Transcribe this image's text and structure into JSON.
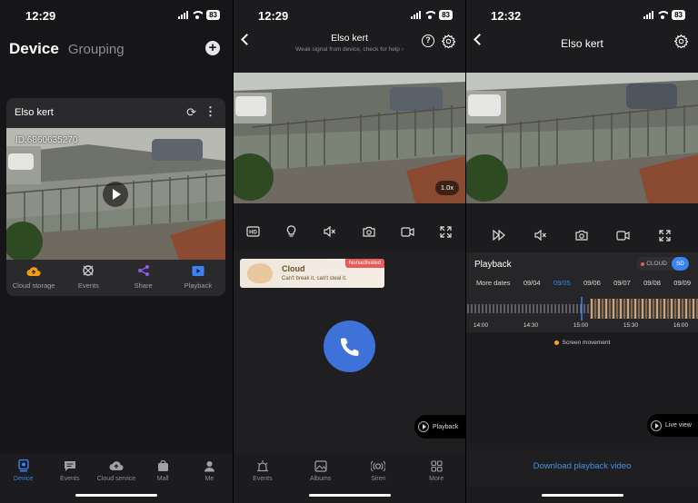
{
  "colors": {
    "accent": "#3b82f6",
    "call_button": "#3f72d8",
    "cloud_storage_icon": "#f39c12",
    "share_icon": "#8e5cf0",
    "playback_icon": "#3b82f6",
    "motion_dot": "#f5a623",
    "nonactivated_badge": "#e65b5b"
  },
  "screen1": {
    "status": {
      "time": "12:29",
      "battery": "83"
    },
    "tabs": {
      "device": "Device",
      "grouping": "Grouping"
    },
    "card": {
      "title": "Elso kert",
      "device_id": "ID:6860635270",
      "actions": [
        {
          "label": "Cloud storage",
          "icon": "cloud-upload-icon"
        },
        {
          "label": "Events",
          "icon": "events-icon"
        },
        {
          "label": "Share",
          "icon": "share-icon"
        },
        {
          "label": "Playback",
          "icon": "playback-icon"
        }
      ]
    },
    "bottom_nav": [
      {
        "label": "Device",
        "icon": "device-icon",
        "active": true
      },
      {
        "label": "Events",
        "icon": "message-icon"
      },
      {
        "label": "Cloud service",
        "icon": "cloud-icon"
      },
      {
        "label": "Mall",
        "icon": "mall-icon"
      },
      {
        "label": "Me",
        "icon": "person-icon"
      }
    ]
  },
  "screen2": {
    "status": {
      "time": "12:29",
      "battery": "83"
    },
    "header": {
      "title": "Elso kert",
      "subtitle": "Weak signal from device, check for help ›"
    },
    "zoom": "1.0x",
    "controls": [
      "hd-icon",
      "light-bulb-icon",
      "mute-icon",
      "camera-icon",
      "record-icon",
      "fullscreen-icon"
    ],
    "cloud_banner": {
      "title": "Cloud",
      "subtitle": "Can't break it, can't steal it.",
      "badge": "Nonactivated"
    },
    "playback_label": "Playback",
    "bottom_nav": [
      {
        "label": "Events",
        "icon": "events-icon"
      },
      {
        "label": "Albums",
        "icon": "albums-icon"
      },
      {
        "label": "Siren",
        "icon": "siren-icon"
      },
      {
        "label": "More",
        "icon": "grid-icon"
      }
    ]
  },
  "screen3": {
    "status": {
      "time": "12:32",
      "battery": "83"
    },
    "header": {
      "title": "Elso kert"
    },
    "controls": [
      "fast-forward-icon",
      "mute-icon",
      "camera-icon",
      "record-icon",
      "fullscreen-icon"
    ],
    "playback": {
      "title": "Playback",
      "storage": {
        "cloud": "CLOUD",
        "sd": "SD",
        "selected": "SD"
      },
      "more_dates": "More dates",
      "dates": [
        "09/04",
        "09/05",
        "09/06",
        "09/07",
        "09/08",
        "09/09"
      ],
      "active_date": "09/05",
      "timeline_labels": [
        "14:00",
        "14:30",
        "15:00",
        "15:30",
        "16:00"
      ],
      "legend": "Screen movement"
    },
    "live_view_label": "Live view",
    "download_label": "Download playback video"
  }
}
